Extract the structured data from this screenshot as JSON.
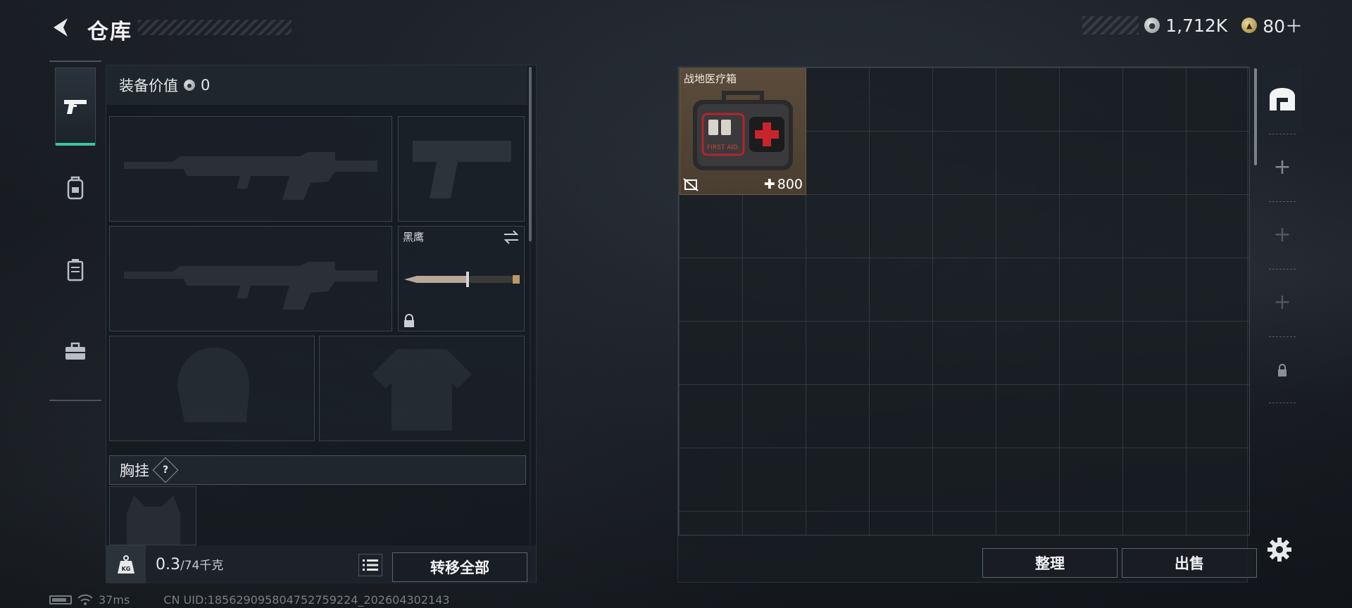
{
  "header": {
    "title": "仓库",
    "currencies": [
      {
        "icon": "silver-coin-icon",
        "value": "1,712K"
      },
      {
        "icon": "gold-coin-icon",
        "value": "80＋"
      }
    ]
  },
  "side_tabs": [
    {
      "icon": "pistol-icon",
      "active": true
    },
    {
      "icon": "backpack-icon",
      "active": false
    },
    {
      "icon": "case-icon",
      "active": false
    },
    {
      "icon": "toolbox-icon",
      "active": false
    }
  ],
  "equipment": {
    "value_label": "装备价值",
    "value": "0",
    "melee_name": "黑鹰",
    "chest_label": "胸挂",
    "help_symbol": "?",
    "weight_current": "0.3",
    "weight_max": "/74千克",
    "weight_icon_text": "KG",
    "transfer_all": "转移全部"
  },
  "storage": {
    "items": [
      {
        "name": "战地医疗箱",
        "price": "800",
        "icon": "first-aid-kit-icon"
      }
    ],
    "kit_text": "FIRST AID",
    "sort_label": "整理",
    "sell_label": "出售"
  },
  "status_bar": {
    "ping": "37ms",
    "uid": "CN UID:1856290958047527592​24_202604302143"
  },
  "colors": {
    "accent_green": "#3fc49a",
    "item_bg": "#4a3e31"
  }
}
